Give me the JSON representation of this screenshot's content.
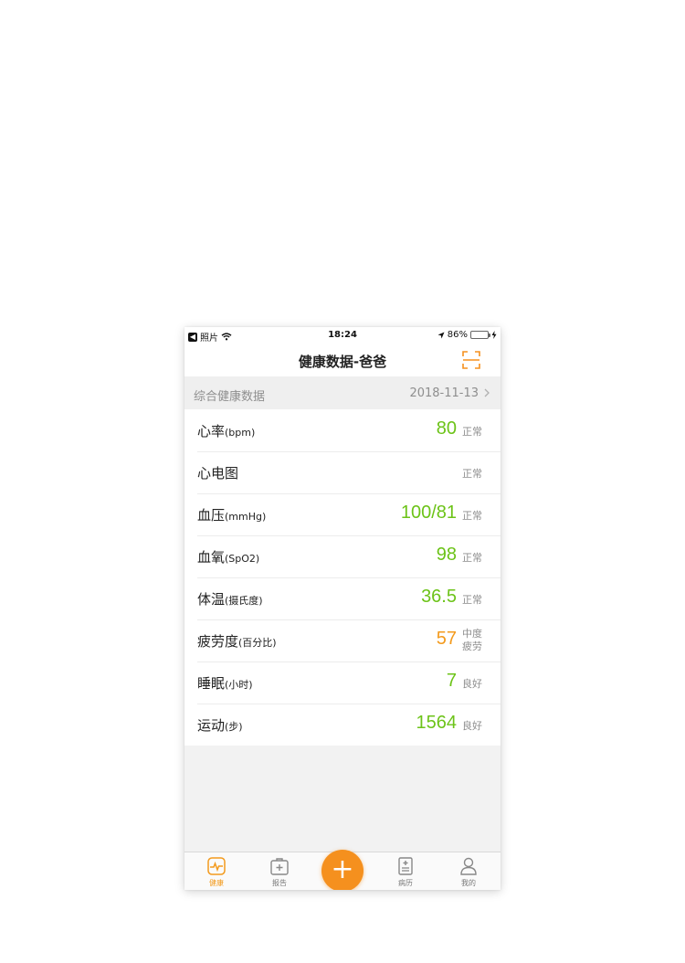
{
  "status_bar": {
    "back_app": "照片",
    "time": "18:24",
    "battery": "86%"
  },
  "nav": {
    "title": "健康数据-爸爸"
  },
  "section": {
    "title": "综合健康数据",
    "date": "2018-11-13"
  },
  "rows": [
    {
      "label": "心率",
      "unit": "(bpm)",
      "value": "80",
      "status": "正常"
    },
    {
      "label": "心电图",
      "unit": "",
      "value": "",
      "status": "正常"
    },
    {
      "label": "血压",
      "unit": "(mmHg)",
      "value": "100/81",
      "status": "正常"
    },
    {
      "label": "血氧",
      "unit": "(SpO2)",
      "value": "98",
      "status": "正常"
    },
    {
      "label": "体温",
      "unit": "(摄氏度)",
      "value": "36.5",
      "status": "正常"
    },
    {
      "label": "疲劳度",
      "unit": "(百分比)",
      "value": "57",
      "status_line1": "中度",
      "status_line2": "疲劳"
    },
    {
      "label": "睡眠",
      "unit": "(小时)",
      "value": "7",
      "status": "良好"
    },
    {
      "label": "运动",
      "unit": "(步)",
      "value": "1564",
      "status": "良好"
    }
  ],
  "tabs": [
    {
      "label": "健康",
      "icon": "health-icon"
    },
    {
      "label": "报告",
      "icon": "report-icon"
    },
    {
      "label": "病历",
      "icon": "medical-record-icon"
    },
    {
      "label": "我的",
      "icon": "profile-icon"
    }
  ],
  "add_button": "+",
  "colors": {
    "accent": "#f5901e",
    "normal_value": "#6cc318",
    "warn_value": "#f39a1c"
  }
}
